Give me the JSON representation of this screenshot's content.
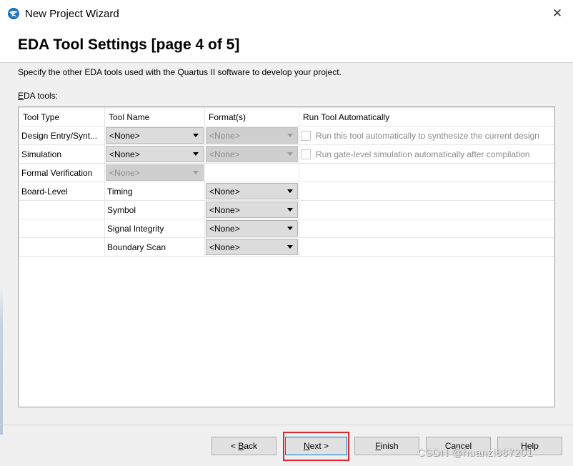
{
  "window": {
    "title": "New Project Wizard",
    "close_glyph": "✕",
    "app_icon": "globe-icon"
  },
  "header": {
    "title": "EDA Tool Settings [page 4 of 5]"
  },
  "description": "Specify the other EDA tools used with the Quartus II software to develop your project.",
  "section": {
    "label_mnemonic": "E",
    "label_rest": "DA tools:"
  },
  "table": {
    "columns": [
      "Tool Type",
      "Tool Name",
      "Format(s)",
      "Run Tool Automatically"
    ],
    "rows": {
      "design_entry": {
        "tool_type": "Design Entry/Synt...",
        "tool_name": "<None>",
        "format": "<None>",
        "auto_label": "Run this tool automatically to synthesize the current design"
      },
      "simulation": {
        "tool_type": "Simulation",
        "tool_name": "<None>",
        "format": "<None>",
        "auto_label": "Run gate-level simulation automatically after compilation"
      },
      "formal": {
        "tool_type": "Formal Verification",
        "tool_name": "<None>"
      },
      "board_level": {
        "tool_type": "Board-Level",
        "items": [
          {
            "name": "Timing",
            "format": "<None>"
          },
          {
            "name": "Symbol",
            "format": "<None>"
          },
          {
            "name": "Signal Integrity",
            "format": "<None>"
          },
          {
            "name": "Boundary Scan",
            "format": "<None>"
          }
        ]
      }
    }
  },
  "footer": {
    "back": {
      "mnemonic": "B",
      "prefix": "< ",
      "rest": "ack"
    },
    "next": {
      "mnemonic": "N",
      "rest": "ext >"
    },
    "finish": {
      "mnemonic": "F",
      "rest": "inish"
    },
    "cancel": "Cancel",
    "help": {
      "mnemonic": "H",
      "rest": "elp"
    }
  },
  "watermark": "CSDN @huanzi887201"
}
